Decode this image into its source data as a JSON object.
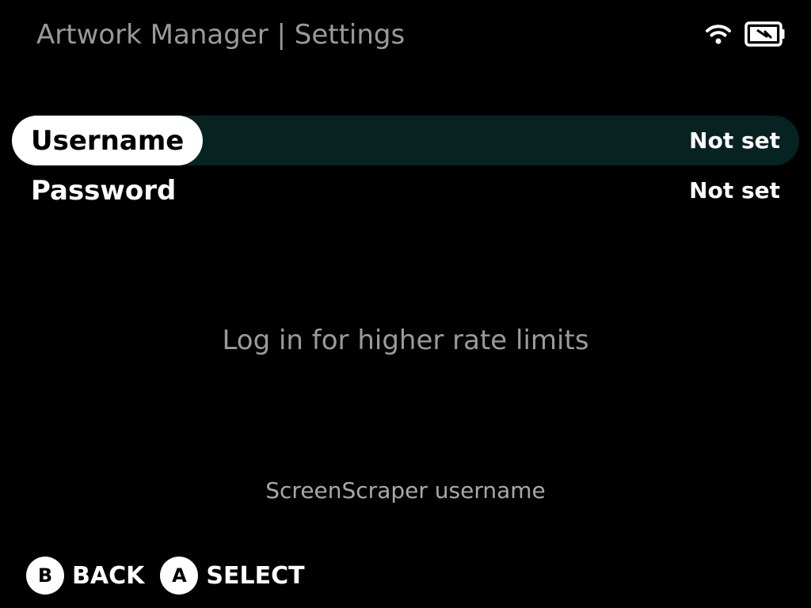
{
  "header": {
    "title": "Artwork Manager | Settings",
    "status_icons": [
      "wifi-icon",
      "battery-icon"
    ]
  },
  "menu": {
    "items": [
      {
        "label": "Username",
        "value": "Not set",
        "selected": true
      },
      {
        "label": "Password",
        "value": "Not set",
        "selected": false
      }
    ]
  },
  "hint": "Log in for higher rate limits",
  "description": "ScreenScraper username",
  "footer": {
    "back": {
      "button": "B",
      "label": "BACK"
    },
    "select": {
      "button": "A",
      "label": "SELECT"
    }
  },
  "colors": {
    "background": "#000000",
    "selected_row": "#062321",
    "header_text": "#9a9a9a"
  }
}
